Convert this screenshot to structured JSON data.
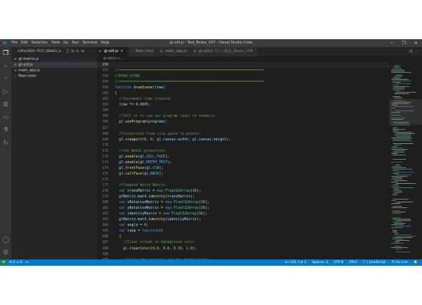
{
  "window": {
    "title": "gl-util.js - Test_Boxes_V07 - Visual Studio Code",
    "menu": [
      "File",
      "Edit",
      "Selection",
      "View",
      "Go",
      "Run",
      "Terminal",
      "Help"
    ],
    "controls": [
      "─",
      "❐",
      "✕"
    ]
  },
  "activity_bar": [
    "explorer-icon",
    "search-icon",
    "source-control-icon",
    "run-debug-icon",
    "extensions-icon",
    "remote-explorer-icon",
    "testing-icon",
    "live-share-icon",
    "account-icon",
    "settings-gear-icon"
  ],
  "sidebar": {
    "header": "EXPLORER: TEST_BOXES_V...",
    "files": [
      {
        "name": "gl-matrix.js",
        "type": "js",
        "selected": false
      },
      {
        "name": "gl-util.js",
        "type": "js",
        "selected": true
      },
      {
        "name": "main_app.js",
        "type": "js",
        "selected": false
      },
      {
        "name": "Main.html",
        "type": "html",
        "selected": false
      }
    ]
  },
  "tabs": [
    {
      "label": "gl-util.js",
      "sub": "",
      "active": true,
      "type": "js"
    },
    {
      "label": "Main.html",
      "sub": "",
      "active": false,
      "type": "html"
    },
    {
      "label": "main_app.js",
      "sub": "",
      "active": false,
      "type": "js"
    },
    {
      "label": "gl-util.js",
      "sub": "C:\\...\\Test_Boxes_V06",
      "active": false,
      "type": "js"
    }
  ],
  "breadcrumb": "gl-util.js > ...",
  "code_lines": [
    {
      "n": "156",
      "cur": true,
      "tokens": []
    },
    {
      "n": "157",
      "tokens": [
        {
          "c": "c",
          "t": "//====================================================================="
        }
      ]
    },
    {
      "n": "158",
      "tokens": [
        {
          "c": "c",
          "t": "//DRAW_SCENE."
        }
      ]
    },
    {
      "n": "159",
      "tokens": [
        {
          "c": "c",
          "t": "//====================================================================="
        }
      ]
    },
    {
      "n": "160",
      "tokens": [
        {
          "c": "k",
          "t": "function "
        },
        {
          "c": "f",
          "t": "drawScene"
        },
        {
          "c": "p",
          "t": "("
        },
        {
          "c": "v",
          "t": "time"
        },
        {
          "c": "p",
          "t": ")"
        }
      ]
    },
    {
      "n": "161",
      "tokens": [
        {
          "c": "p",
          "t": "{"
        }
      ]
    },
    {
      "n": "162",
      "tokens": [
        {
          "c": "c",
          "t": "  //Increment time interval."
        }
      ]
    },
    {
      "n": "163",
      "tokens": [
        {
          "c": "p",
          "t": "  "
        },
        {
          "c": "v",
          "t": "time"
        },
        {
          "c": "p",
          "t": " *= "
        },
        {
          "c": "n",
          "t": "0.0005"
        },
        {
          "c": "p",
          "t": ";"
        }
      ]
    },
    {
      "n": "164",
      "tokens": []
    },
    {
      "n": "165",
      "tokens": [
        {
          "c": "c",
          "t": "  //Tell it to use our program (pair of shaders)"
        }
      ]
    },
    {
      "n": "166",
      "tokens": [
        {
          "c": "p",
          "t": "  "
        },
        {
          "c": "v",
          "t": "gl"
        },
        {
          "c": "p",
          "t": "."
        },
        {
          "c": "f",
          "t": "useProgram"
        },
        {
          "c": "p",
          "t": "("
        },
        {
          "c": "v",
          "t": "program"
        },
        {
          "c": "p",
          "t": ");"
        }
      ]
    },
    {
      "n": "167",
      "tokens": []
    },
    {
      "n": "168",
      "tokens": [
        {
          "c": "c",
          "t": "  //Conversion from clip space to pixels."
        }
      ]
    },
    {
      "n": "169",
      "tokens": [
        {
          "c": "p",
          "t": "  "
        },
        {
          "c": "v",
          "t": "gl"
        },
        {
          "c": "p",
          "t": "."
        },
        {
          "c": "f",
          "t": "viewport"
        },
        {
          "c": "p",
          "t": "("
        },
        {
          "c": "n",
          "t": "0"
        },
        {
          "c": "p",
          "t": ", "
        },
        {
          "c": "n",
          "t": "0"
        },
        {
          "c": "p",
          "t": ", "
        },
        {
          "c": "v",
          "t": "gl"
        },
        {
          "c": "p",
          "t": "."
        },
        {
          "c": "v",
          "t": "canvas"
        },
        {
          "c": "p",
          "t": "."
        },
        {
          "c": "v",
          "t": "width"
        },
        {
          "c": "p",
          "t": ", "
        },
        {
          "c": "v",
          "t": "gl"
        },
        {
          "c": "p",
          "t": "."
        },
        {
          "c": "v",
          "t": "canvas"
        },
        {
          "c": "p",
          "t": "."
        },
        {
          "c": "v",
          "t": "height"
        },
        {
          "c": "p",
          "t": ");"
        }
      ]
    },
    {
      "n": "170",
      "tokens": []
    },
    {
      "n": "171",
      "tokens": [
        {
          "c": "c",
          "t": "  //Set WebGL properties."
        }
      ]
    },
    {
      "n": "172",
      "tokens": [
        {
          "c": "p",
          "t": "  "
        },
        {
          "c": "v",
          "t": "gl"
        },
        {
          "c": "p",
          "t": "."
        },
        {
          "c": "f",
          "t": "enable"
        },
        {
          "c": "p",
          "t": "("
        },
        {
          "c": "v",
          "t": "gl"
        },
        {
          "c": "p",
          "t": "."
        },
        {
          "c": "cn",
          "t": "CULL_FACE"
        },
        {
          "c": "p",
          "t": ");"
        }
      ]
    },
    {
      "n": "173",
      "tokens": [
        {
          "c": "p",
          "t": "  "
        },
        {
          "c": "v",
          "t": "gl"
        },
        {
          "c": "p",
          "t": "."
        },
        {
          "c": "f",
          "t": "enable"
        },
        {
          "c": "p",
          "t": "("
        },
        {
          "c": "v",
          "t": "gl"
        },
        {
          "c": "p",
          "t": "."
        },
        {
          "c": "cn",
          "t": "DEPTH_TEST"
        },
        {
          "c": "p",
          "t": ");"
        }
      ]
    },
    {
      "n": "174",
      "tokens": [
        {
          "c": "p",
          "t": "  "
        },
        {
          "c": "v",
          "t": "gl"
        },
        {
          "c": "p",
          "t": "."
        },
        {
          "c": "f",
          "t": "frontFace"
        },
        {
          "c": "p",
          "t": "("
        },
        {
          "c": "v",
          "t": "gl"
        },
        {
          "c": "p",
          "t": "."
        },
        {
          "c": "cn",
          "t": "CCW"
        },
        {
          "c": "p",
          "t": ");"
        }
      ]
    },
    {
      "n": "175",
      "tokens": [
        {
          "c": "p",
          "t": "  "
        },
        {
          "c": "v",
          "t": "gl"
        },
        {
          "c": "p",
          "t": "."
        },
        {
          "c": "f",
          "t": "cullFace"
        },
        {
          "c": "p",
          "t": "("
        },
        {
          "c": "v",
          "t": "gl"
        },
        {
          "c": "p",
          "t": "."
        },
        {
          "c": "cn",
          "t": "BACK"
        },
        {
          "c": "p",
          "t": ");"
        }
      ]
    },
    {
      "n": "176",
      "tokens": []
    },
    {
      "n": "177",
      "tokens": [
        {
          "c": "c",
          "t": "  //Compose World Matrix."
        }
      ]
    },
    {
      "n": "178",
      "tokens": [
        {
          "c": "k",
          "t": "  var "
        },
        {
          "c": "v",
          "t": "transMatrix"
        },
        {
          "c": "p",
          "t": " = "
        },
        {
          "c": "k",
          "t": "new "
        },
        {
          "c": "t",
          "t": "Float32Array"
        },
        {
          "c": "p",
          "t": "("
        },
        {
          "c": "n",
          "t": "16"
        },
        {
          "c": "p",
          "t": ");"
        }
      ]
    },
    {
      "n": "179",
      "tokens": [
        {
          "c": "p",
          "t": "  "
        },
        {
          "c": "v",
          "t": "glMatrix"
        },
        {
          "c": "p",
          "t": "."
        },
        {
          "c": "v",
          "t": "mat4"
        },
        {
          "c": "p",
          "t": "."
        },
        {
          "c": "f",
          "t": "identity"
        },
        {
          "c": "p",
          "t": "("
        },
        {
          "c": "v",
          "t": "transMatrix"
        },
        {
          "c": "p",
          "t": ");"
        }
      ]
    },
    {
      "n": "180",
      "tokens": [
        {
          "c": "k",
          "t": "  var "
        },
        {
          "c": "v",
          "t": "xRotationMatrix"
        },
        {
          "c": "p",
          "t": " = "
        },
        {
          "c": "k",
          "t": "new "
        },
        {
          "c": "t",
          "t": "Float32Array"
        },
        {
          "c": "p",
          "t": "("
        },
        {
          "c": "n",
          "t": "16"
        },
        {
          "c": "p",
          "t": ");"
        }
      ]
    },
    {
      "n": "181",
      "tokens": [
        {
          "c": "k",
          "t": "  var "
        },
        {
          "c": "v",
          "t": "yRotationMatrix"
        },
        {
          "c": "p",
          "t": " = "
        },
        {
          "c": "k",
          "t": "new "
        },
        {
          "c": "t",
          "t": "Float32Array"
        },
        {
          "c": "p",
          "t": "("
        },
        {
          "c": "n",
          "t": "16"
        },
        {
          "c": "p",
          "t": ");"
        }
      ]
    },
    {
      "n": "182",
      "tokens": [
        {
          "c": "k",
          "t": "  var "
        },
        {
          "c": "v",
          "t": "identityMatrix"
        },
        {
          "c": "p",
          "t": " = "
        },
        {
          "c": "k",
          "t": "new "
        },
        {
          "c": "t",
          "t": "Float32Array"
        },
        {
          "c": "p",
          "t": "("
        },
        {
          "c": "n",
          "t": "16"
        },
        {
          "c": "p",
          "t": ");"
        }
      ]
    },
    {
      "n": "183",
      "tokens": [
        {
          "c": "p",
          "t": "  "
        },
        {
          "c": "v",
          "t": "glMatrix"
        },
        {
          "c": "p",
          "t": "."
        },
        {
          "c": "v",
          "t": "mat4"
        },
        {
          "c": "p",
          "t": "."
        },
        {
          "c": "f",
          "t": "identity"
        },
        {
          "c": "p",
          "t": "("
        },
        {
          "c": "v",
          "t": "identityMatrix"
        },
        {
          "c": "p",
          "t": ");"
        }
      ]
    },
    {
      "n": "184",
      "tokens": [
        {
          "c": "k",
          "t": "  var "
        },
        {
          "c": "v",
          "t": "angle"
        },
        {
          "c": "p",
          "t": " = "
        },
        {
          "c": "n",
          "t": "0"
        },
        {
          "c": "p",
          "t": ";"
        }
      ]
    },
    {
      "n": "185",
      "tokens": [
        {
          "c": "k",
          "t": "  var "
        },
        {
          "c": "f",
          "t": "loop"
        },
        {
          "c": "p",
          "t": " = "
        },
        {
          "c": "k",
          "t": "function"
        },
        {
          "c": "p",
          "t": "()"
        }
      ]
    },
    {
      "n": "186",
      "tokens": [
        {
          "c": "p",
          "t": "  {"
        }
      ]
    },
    {
      "n": "187",
      "tokens": [
        {
          "c": "c",
          "t": "    //Clear screen to background color."
        }
      ]
    },
    {
      "n": "188",
      "tokens": [
        {
          "c": "p",
          "t": "    "
        },
        {
          "c": "v",
          "t": "gl"
        },
        {
          "c": "p",
          "t": "."
        },
        {
          "c": "f",
          "t": "clearColor"
        },
        {
          "c": "p",
          "t": "("
        },
        {
          "c": "n",
          "t": "0.0"
        },
        {
          "c": "p",
          "t": ", "
        },
        {
          "c": "n",
          "t": "0.0"
        },
        {
          "c": "p",
          "t": ", "
        },
        {
          "c": "n",
          "t": "0.15"
        },
        {
          "c": "p",
          "t": ", "
        },
        {
          "c": "n",
          "t": "1.0"
        },
        {
          "c": "p",
          "t": ");"
        }
      ]
    },
    {
      "n": "189",
      "tokens": []
    },
    {
      "n": "190",
      "tokens": [
        {
          "c": "c",
          "t": "    //Clear the canvases and the depth buffer."
        }
      ]
    },
    {
      "n": "191",
      "tokens": [
        {
          "c": "p",
          "t": "    "
        },
        {
          "c": "v",
          "t": "gl"
        },
        {
          "c": "p",
          "t": "."
        },
        {
          "c": "f",
          "t": "clear"
        },
        {
          "c": "p",
          "t": "("
        },
        {
          "c": "v",
          "t": "gl"
        },
        {
          "c": "p",
          "t": "."
        },
        {
          "c": "cn",
          "t": "COLOR_BUFFER_BIT"
        },
        {
          "c": "p",
          "t": " | "
        },
        {
          "c": "v",
          "t": "gl"
        },
        {
          "c": "p",
          "t": "."
        },
        {
          "c": "cn",
          "t": "DEPTH_BUFFER_BIT"
        },
        {
          "c": "p",
          "t": ");"
        }
      ]
    },
    {
      "n": "192",
      "tokens": []
    },
    {
      "n": "193",
      "tokens": [
        {
          "c": "c",
          "t": "    //Calculate next angle."
        }
      ]
    }
  ],
  "status": {
    "remote": "⋊",
    "errors": "⊗ 0 ⚠ 0",
    "home": "⌂",
    "position": "Ln 156, Col 1",
    "spaces": "Spaces: 2",
    "encoding": "UTF-8",
    "eol": "CRLF",
    "language": "{ } JavaScript",
    "golive": "⦿ Go Live",
    "bell": "🔔"
  }
}
